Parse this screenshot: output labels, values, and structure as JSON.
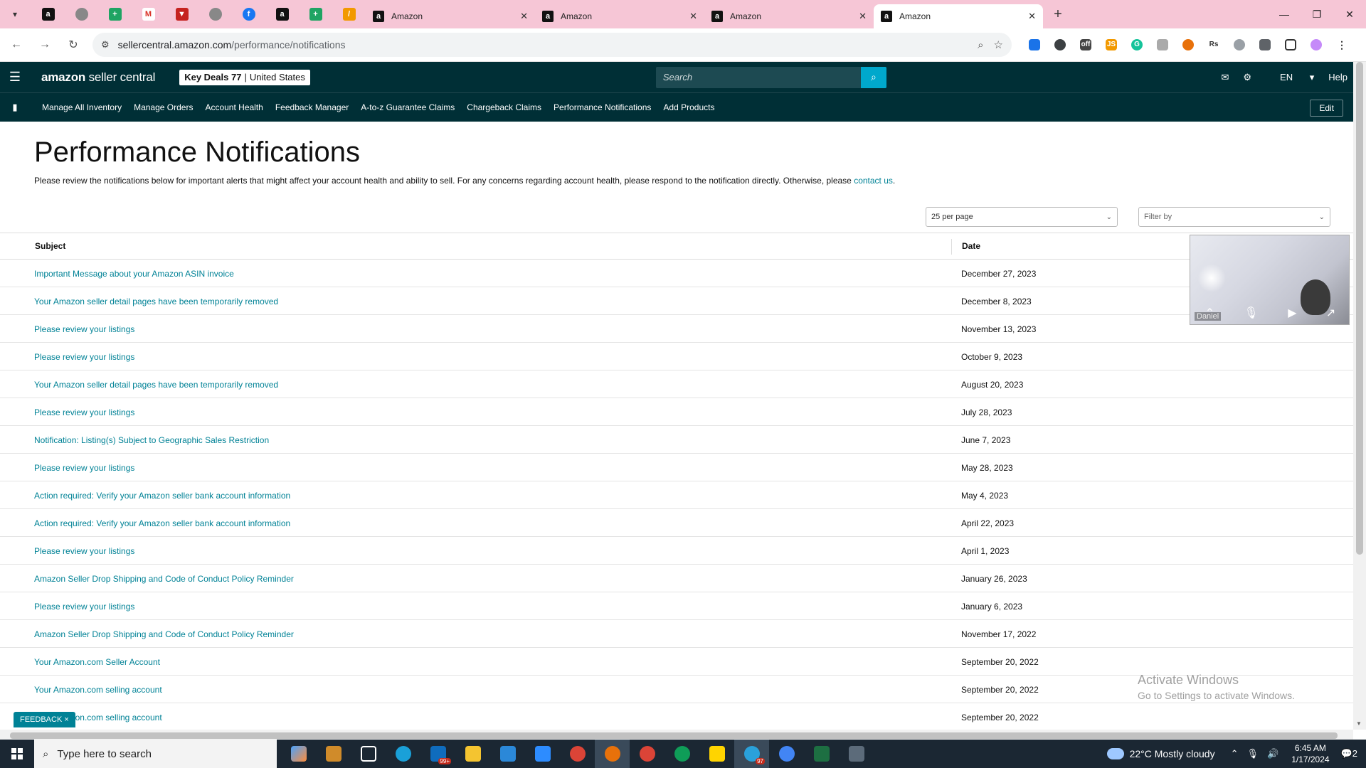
{
  "browser": {
    "tabs": [
      {
        "title": "Amazon",
        "active": false
      },
      {
        "title": "Amazon",
        "active": false
      },
      {
        "title": "Amazon",
        "active": false
      },
      {
        "title": "Amazon",
        "active": true
      }
    ],
    "url_host": "sellercentral.amazon.com",
    "url_path": "/performance/notifications"
  },
  "header": {
    "logo_brand": "amazon",
    "logo_product": "seller central",
    "store_name": "Key Deals 77",
    "store_region": "United States",
    "search_placeholder": "Search",
    "language": "EN",
    "help": "Help"
  },
  "nav": {
    "links": [
      "Manage All Inventory",
      "Manage Orders",
      "Account Health",
      "Feedback Manager",
      "A-to-z Guarantee Claims",
      "Chargeback Claims",
      "Performance Notifications",
      "Add Products"
    ],
    "edit": "Edit"
  },
  "page": {
    "title": "Performance Notifications",
    "intro_text": "Please review the notifications below for important alerts that might affect your account health and ability to sell. For any concerns regarding account health, please respond to the notification directly. Otherwise, please ",
    "intro_link": "contact us",
    "intro_end": ".",
    "per_page": "25 per page",
    "filter_placeholder": "Filter by"
  },
  "table": {
    "headers": {
      "subject": "Subject",
      "date": "Date"
    },
    "rows": [
      {
        "subject": "Important Message about your Amazon ASIN invoice",
        "date": "December 27, 2023"
      },
      {
        "subject": "Your Amazon seller detail pages have been temporarily removed",
        "date": "December 8, 2023"
      },
      {
        "subject": "Please review your listings",
        "date": "November 13, 2023"
      },
      {
        "subject": "Please review your listings",
        "date": "October 9, 2023"
      },
      {
        "subject": "Your Amazon seller detail pages have been temporarily removed",
        "date": "August 20, 2023"
      },
      {
        "subject": "Please review your listings",
        "date": "July 28, 2023"
      },
      {
        "subject": "Notification: Listing(s) Subject to Geographic Sales Restriction",
        "date": "June 7, 2023"
      },
      {
        "subject": "Please review your listings",
        "date": "May 28, 2023"
      },
      {
        "subject": "Action required: Verify your Amazon seller bank account information",
        "date": "May 4, 2023"
      },
      {
        "subject": "Action required: Verify your Amazon seller bank account information",
        "date": "April 22, 2023"
      },
      {
        "subject": "Please review your listings",
        "date": "April 1, 2023"
      },
      {
        "subject": "Amazon Seller Drop Shipping and Code of Conduct Policy Reminder",
        "date": "January 26, 2023"
      },
      {
        "subject": "Please review your listings",
        "date": "January 6, 2023"
      },
      {
        "subject": "Amazon Seller Drop Shipping and Code of Conduct Policy Reminder",
        "date": "November 17, 2022"
      },
      {
        "subject": "Your Amazon.com Seller Account",
        "date": "September 20, 2022"
      },
      {
        "subject": "Your Amazon.com selling account",
        "date": "September 20, 2022"
      },
      {
        "subject": "Your Amazon.com selling account",
        "date": "September 20, 2022"
      }
    ]
  },
  "overlays": {
    "video_name": "Daniel",
    "watermark_line1": "Activate Windows",
    "watermark_line2": "Go to Settings to activate Windows.",
    "feedback": "FEEDBACK ×"
  },
  "taskbar": {
    "search_placeholder": "Type here to search",
    "weather": "22°C  Mostly cloudy",
    "time": "6:45 AM",
    "date": "1/17/2024",
    "badge_mail": "99+",
    "badge_telegram": "97",
    "notif_count": "2"
  },
  "colors": {
    "header_bg": "#002f36",
    "link": "#008296",
    "search_button": "#00a8cc",
    "tabstrip_bg": "#f6c6d6"
  }
}
